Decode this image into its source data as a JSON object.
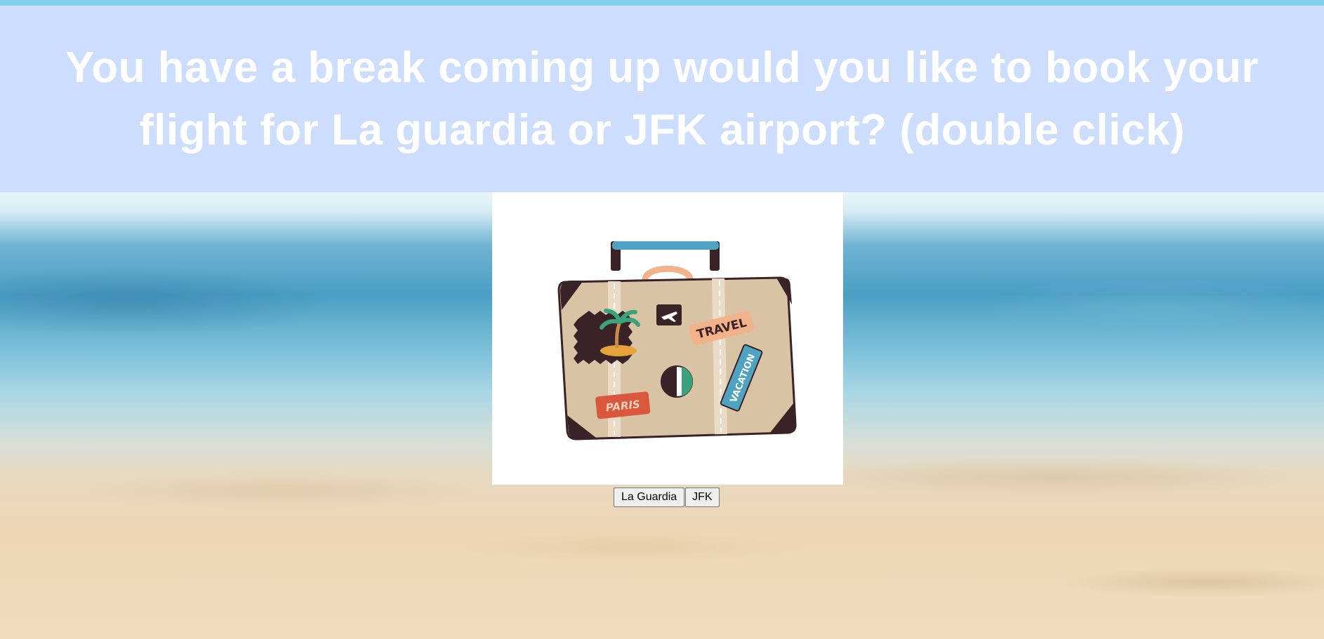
{
  "prompt": {
    "text": "You have a break coming up would you like to book your flight for La guardia or JFK airport? (double click)"
  },
  "image": {
    "stickers": {
      "travel": "TRAVEL",
      "vacation": "VACATION",
      "paris": "PARIS"
    }
  },
  "buttons": {
    "la_guardia": "La Guardia",
    "jfk": "JFK"
  },
  "colors": {
    "banner_bg": "#ccddfd",
    "banner_text": "#ffffff",
    "suitcase_body": "#d9c3a5",
    "handle": "#4fa3c2"
  }
}
